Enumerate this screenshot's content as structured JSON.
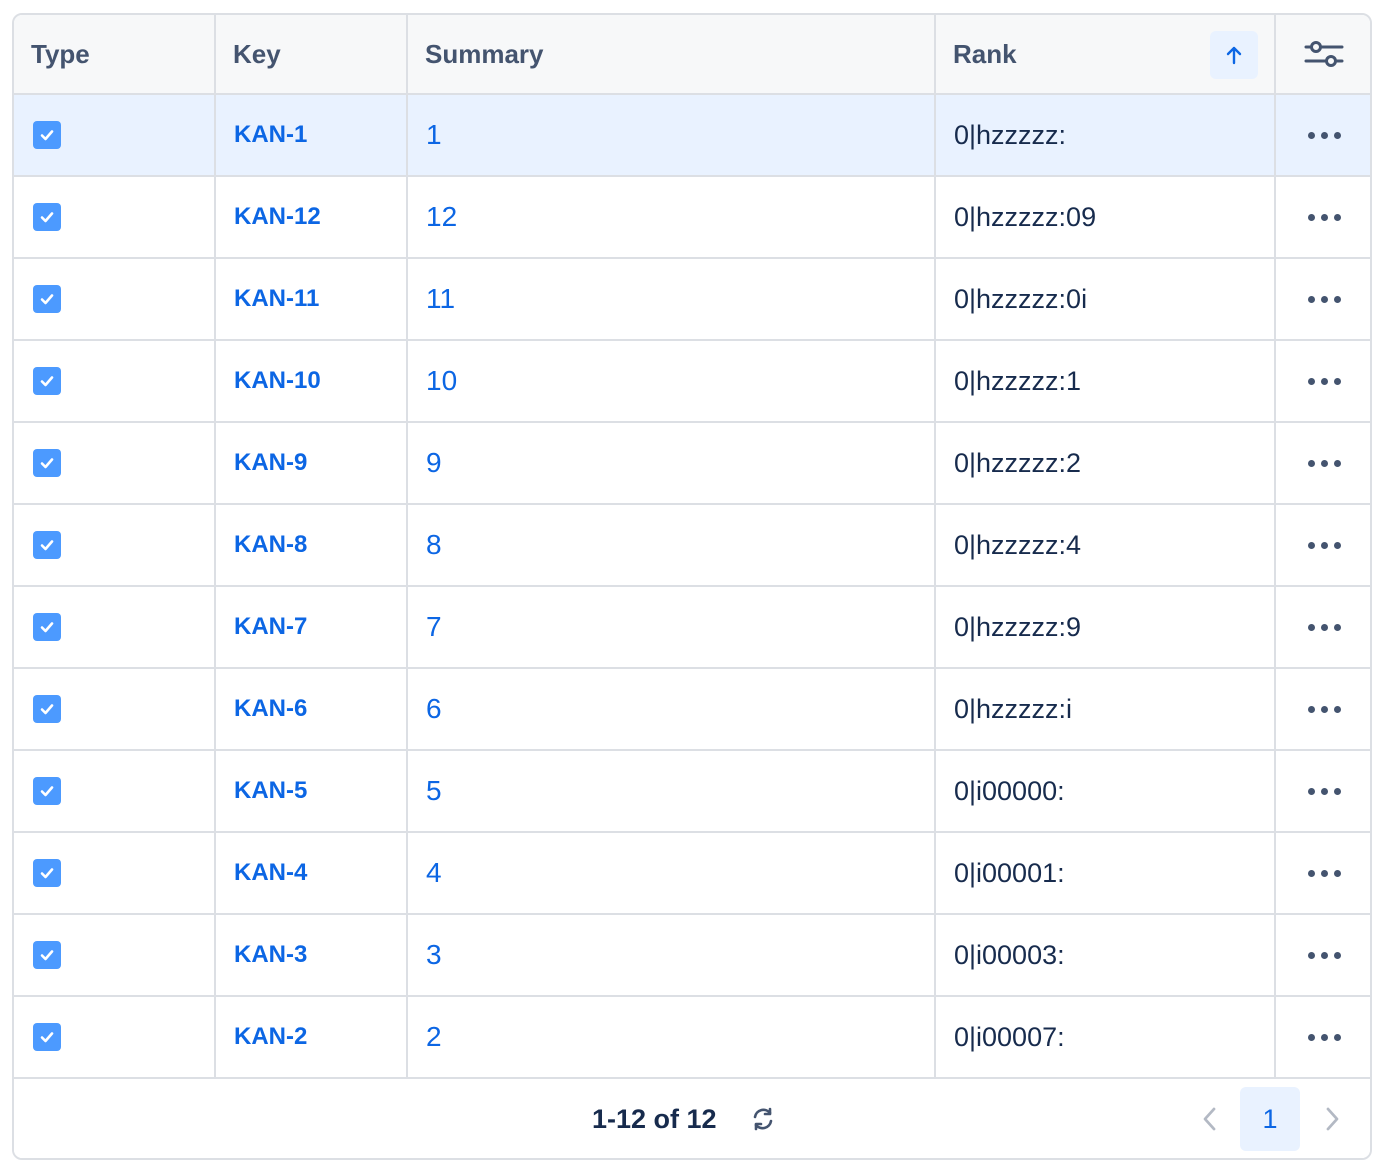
{
  "columns": {
    "type": "Type",
    "key": "Key",
    "summary": "Summary",
    "rank": "Rank"
  },
  "header_icons": {
    "sort": "arrow-up-icon",
    "settings": "sliders-icon"
  },
  "rows": [
    {
      "type_icon": "checkbox-task-icon",
      "key": "KAN-1",
      "summary": "1",
      "rank": "0|hzzzzz:",
      "selected": true
    },
    {
      "type_icon": "checkbox-task-icon",
      "key": "KAN-12",
      "summary": "12",
      "rank": "0|hzzzzz:09",
      "selected": false
    },
    {
      "type_icon": "checkbox-task-icon",
      "key": "KAN-11",
      "summary": "11",
      "rank": "0|hzzzzz:0i",
      "selected": false
    },
    {
      "type_icon": "checkbox-task-icon",
      "key": "KAN-10",
      "summary": "10",
      "rank": "0|hzzzzz:1",
      "selected": false
    },
    {
      "type_icon": "checkbox-task-icon",
      "key": "KAN-9",
      "summary": "9",
      "rank": "0|hzzzzz:2",
      "selected": false
    },
    {
      "type_icon": "checkbox-task-icon",
      "key": "KAN-8",
      "summary": "8",
      "rank": "0|hzzzzz:4",
      "selected": false
    },
    {
      "type_icon": "checkbox-task-icon",
      "key": "KAN-7",
      "summary": "7",
      "rank": "0|hzzzzz:9",
      "selected": false
    },
    {
      "type_icon": "checkbox-task-icon",
      "key": "KAN-6",
      "summary": "6",
      "rank": "0|hzzzzz:i",
      "selected": false
    },
    {
      "type_icon": "checkbox-task-icon",
      "key": "KAN-5",
      "summary": "5",
      "rank": "0|i00000:",
      "selected": false
    },
    {
      "type_icon": "checkbox-task-icon",
      "key": "KAN-4",
      "summary": "4",
      "rank": "0|i00001:",
      "selected": false
    },
    {
      "type_icon": "checkbox-task-icon",
      "key": "KAN-3",
      "summary": "3",
      "rank": "0|i00003:",
      "selected": false
    },
    {
      "type_icon": "checkbox-task-icon",
      "key": "KAN-2",
      "summary": "2",
      "rank": "0|i00007:",
      "selected": false
    }
  ],
  "footer": {
    "count_text": "1-12 of 12",
    "current_page": "1"
  },
  "colors": {
    "accent": "#0c66e4",
    "selected_row": "#e9f2ff",
    "task_icon": "#4c9aff",
    "border": "#dcdfe4"
  }
}
